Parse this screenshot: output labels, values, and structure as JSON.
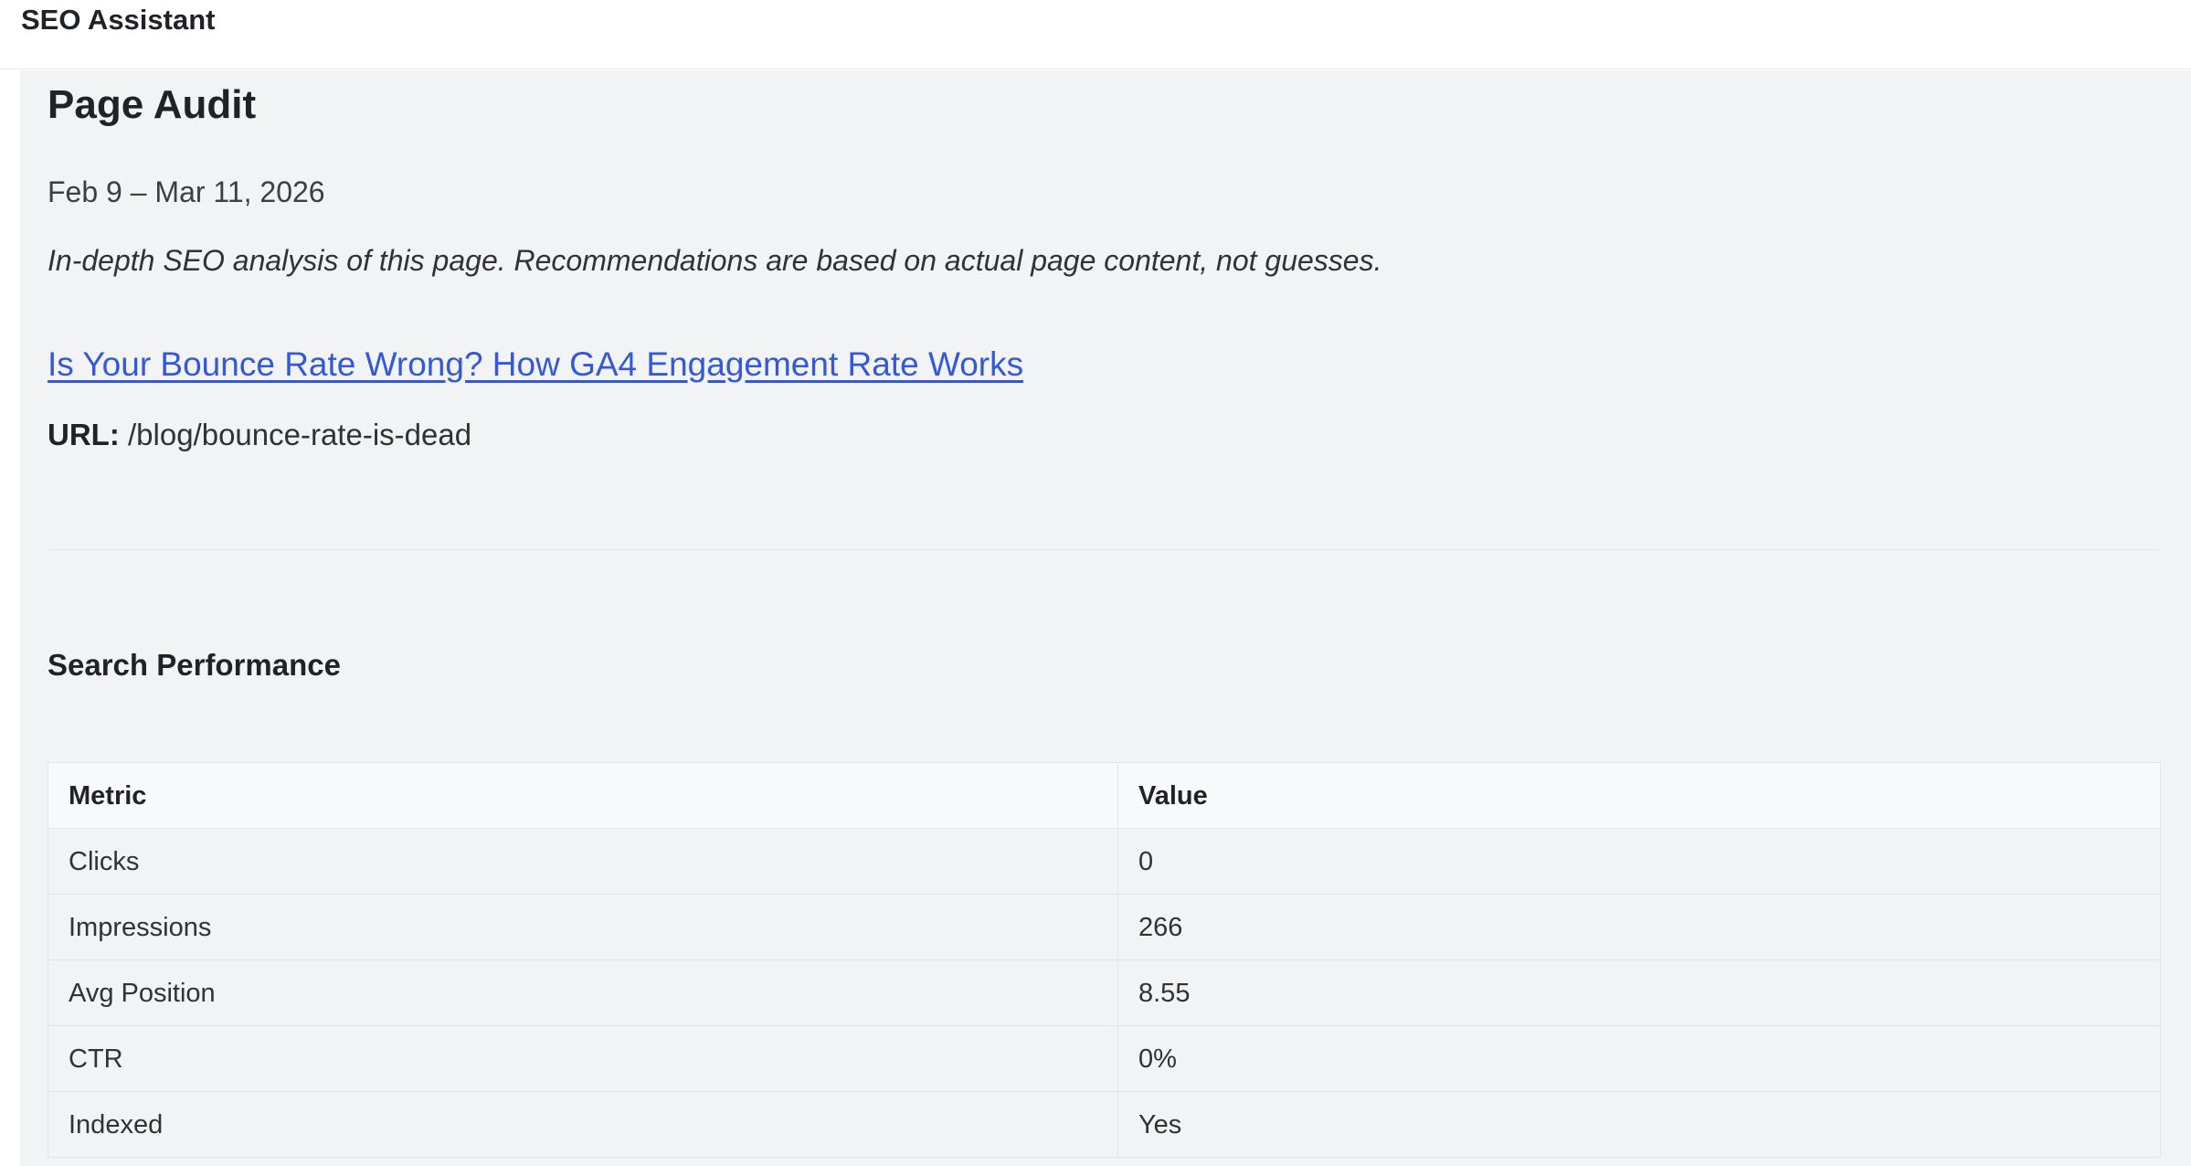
{
  "app": {
    "title": "SEO Assistant"
  },
  "audit": {
    "heading": "Page Audit",
    "date_range": "Feb 9 – Mar 11, 2026",
    "intro": "In-depth SEO analysis of this page. Recommendations are based on actual page content, not guesses.",
    "page_title": "Is Your Bounce Rate Wrong? How GA4 Engagement Rate Works",
    "url_label": "URL:",
    "url_value": "/blog/bounce-rate-is-dead"
  },
  "search_performance": {
    "heading": "Search Performance",
    "columns": [
      "Metric",
      "Value"
    ],
    "rows": [
      {
        "metric": "Clicks",
        "value": "0"
      },
      {
        "metric": "Impressions",
        "value": "266"
      },
      {
        "metric": "Avg Position",
        "value": "8.55"
      },
      {
        "metric": "CTR",
        "value": "0%"
      },
      {
        "metric": "Indexed",
        "value": "Yes"
      }
    ]
  },
  "colors": {
    "link": "#3558d6",
    "content_background": "#f2f3f5",
    "header_background": "#ffffff"
  }
}
